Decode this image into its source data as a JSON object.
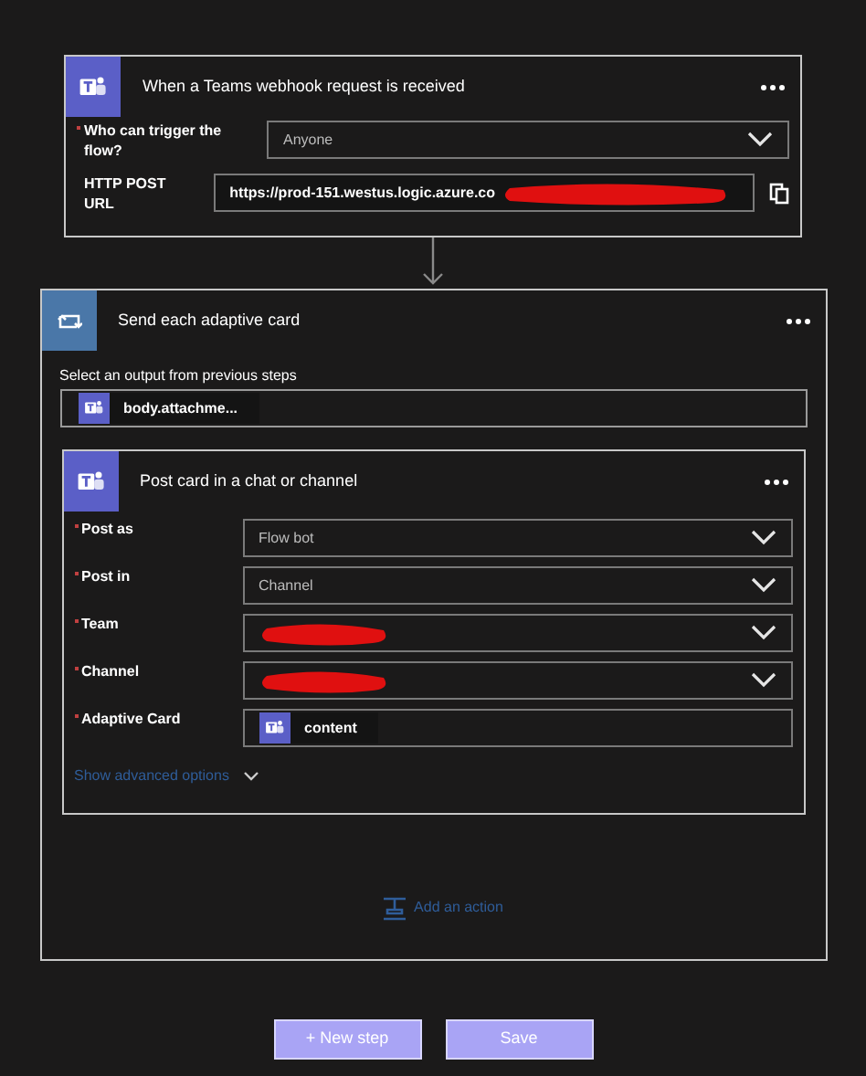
{
  "trigger": {
    "title": "When a Teams webhook request is received",
    "fields": [
      {
        "label": "Who can trigger the flow?",
        "required": true,
        "kind": "dropdown",
        "value": "Anyone",
        "redacted": false
      },
      {
        "label": "HTTP POST URL",
        "required": false,
        "kind": "url",
        "value": "https://prod-151.westus.logic.azure.co",
        "redacted": true
      }
    ]
  },
  "loop": {
    "title": "Send each adaptive card",
    "select_label": "Select an output from previous steps",
    "token": "body.attachme...",
    "action": {
      "title": "Post card in a chat or channel",
      "fields": [
        {
          "label": "Post as",
          "required": true,
          "kind": "dropdown",
          "value": "Flow bot",
          "redacted": false
        },
        {
          "label": "Post in",
          "required": true,
          "kind": "dropdown",
          "value": "Channel",
          "redacted": false
        },
        {
          "label": "Team",
          "required": true,
          "kind": "dropdown",
          "redacted": true
        },
        {
          "label": "Channel",
          "required": true,
          "kind": "dropdown",
          "redacted": true
        },
        {
          "label": "Adaptive Card",
          "required": true,
          "kind": "token",
          "value": "content",
          "redacted": false
        }
      ],
      "advanced": "Show advanced options"
    },
    "add_action": "Add an action"
  },
  "buttons": [
    "+ New step",
    "Save"
  ]
}
